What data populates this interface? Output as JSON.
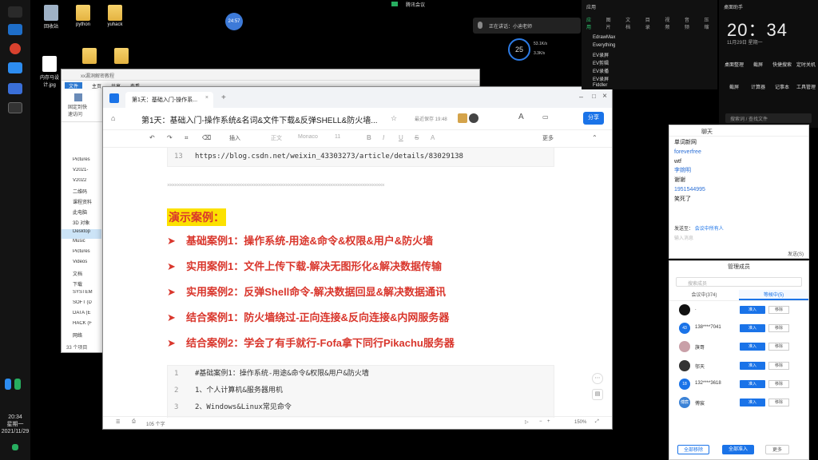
{
  "taskbar": {
    "time": "20:34",
    "weekday": "星期一",
    "date": "2021/11/29"
  },
  "desktop": {
    "icons": [
      {
        "label": "回收站"
      },
      {
        "label": "python"
      },
      {
        "label": "yuhack"
      },
      {
        "label": "内存马设计.jpg"
      }
    ],
    "timer": "24:57",
    "topbar_label": "腾讯会议",
    "floatbar_text": "正在讲话：小迪老师",
    "net": {
      "percent": "25",
      "up": "53.1K/s",
      "down": "3.3K/s"
    }
  },
  "explorer": {
    "title": "xx漏洞解密教程",
    "tabs": [
      "文件",
      "主页",
      "共享",
      "查看"
    ],
    "ribbon_items": [
      "固定到快速访问",
      "复制"
    ],
    "tree": [
      "Pictures",
      "V2021-",
      "V2022",
      "二维码",
      "课程资料",
      "此电脑",
      "3D 对象",
      "Desktop",
      "Music",
      "Pictures",
      "Videos",
      "文档",
      "下载",
      "SYSTEM",
      "SOFT (D",
      "DATA (E",
      "HACK (F",
      "网络"
    ],
    "status": "33 个项目"
  },
  "editor": {
    "tab_title": "第1天：基础入门-操作系...",
    "doc_title": "第1天：基础入门-操作系统&名词&文件下载&反弹SHELL&防火墙...",
    "saved": "最近保存 19:48",
    "share": "分享",
    "toolbar": {
      "insert": "插入",
      "body": "正文",
      "font": "Monaco",
      "size": "11",
      "more": "更多"
    },
    "top_code_ln": "13",
    "top_code": "https://blog.csdn.net/weixin_43303273/article/details/83029138",
    "demo_title": "演示案例：",
    "cases": [
      "基础案例1：操作系统-用途&命令&权限&用户&防火墙",
      "实用案例1：文件上传下载-解决无图形化&解决数据传输",
      "实用案例2：反弹Shell命令-解决数据回显&解决数据通讯",
      "结合案例1：防火墙绕过-正向连接&反向连接&内网服务器",
      "结合案例2：学会了有手就行-Fofa拿下同行Pikachu服务器"
    ],
    "code": [
      {
        "ln": "1",
        "text": "#基础案例1：操作系统-用途&命令&权限&用户&防火墙"
      },
      {
        "ln": "2",
        "text": "1、个人计算机&服务器用机"
      },
      {
        "ln": "3",
        "text": "2、Windows&Linux常见命令"
      }
    ],
    "statusbar": {
      "words": "105 个字",
      "zoom": "150%"
    }
  },
  "applist": {
    "title": "应用",
    "tabs": [
      "应用",
      "图片",
      "文档",
      "目录",
      "视频",
      "音频",
      "压缩"
    ],
    "items": [
      "EdrawMax",
      "Everything",
      "EV录屏",
      "EV剪辑",
      "EV录播",
      "EV录屏",
      "Fiddler"
    ]
  },
  "clockpanel": {
    "label": "桌面助手",
    "time": "20：34",
    "date": "11月29日  星期一",
    "actions": [
      "桌面整理",
      "截屏",
      "快捷搜索",
      "定时关机",
      "截屏",
      "计算器",
      "记事本",
      "工具管理"
    ],
    "search_hint": "搜索词 / 查找文件"
  },
  "chat": {
    "title": "聊天",
    "messages": [
      {
        "text": "单词新网",
        "blue": false
      },
      {
        "text": "foreverfree",
        "blue": true
      },
      {
        "text": "wtf",
        "blue": false
      },
      {
        "text": "李婉明",
        "blue": true
      },
      {
        "text": "谢谢",
        "blue": false
      },
      {
        "text": "1951544995",
        "blue": true
      },
      {
        "text": "笑死了",
        "blue": false
      }
    ],
    "to_label": "发送至：",
    "to_value": "会议中所有人",
    "input_placeholder": "输入消息",
    "send": "发送(S)"
  },
  "members": {
    "title": "管理成员",
    "search_placeholder": "搜索成员",
    "tabs": [
      "会议中(374)",
      "等候中(5)"
    ],
    "rows": [
      {
        "name": ".",
        "av": ""
      },
      {
        "name": "138****7041",
        "av": "43"
      },
      {
        "name": "旗哥",
        "av": ""
      },
      {
        "name": "邬天",
        "av": ""
      },
      {
        "name": "132****3618",
        "av": "18"
      },
      {
        "name": "傅宸",
        "av": "傅宸"
      }
    ],
    "admit": "准入",
    "remove": "移除",
    "footer": [
      "全部移除",
      "全部准入",
      "更多"
    ]
  }
}
